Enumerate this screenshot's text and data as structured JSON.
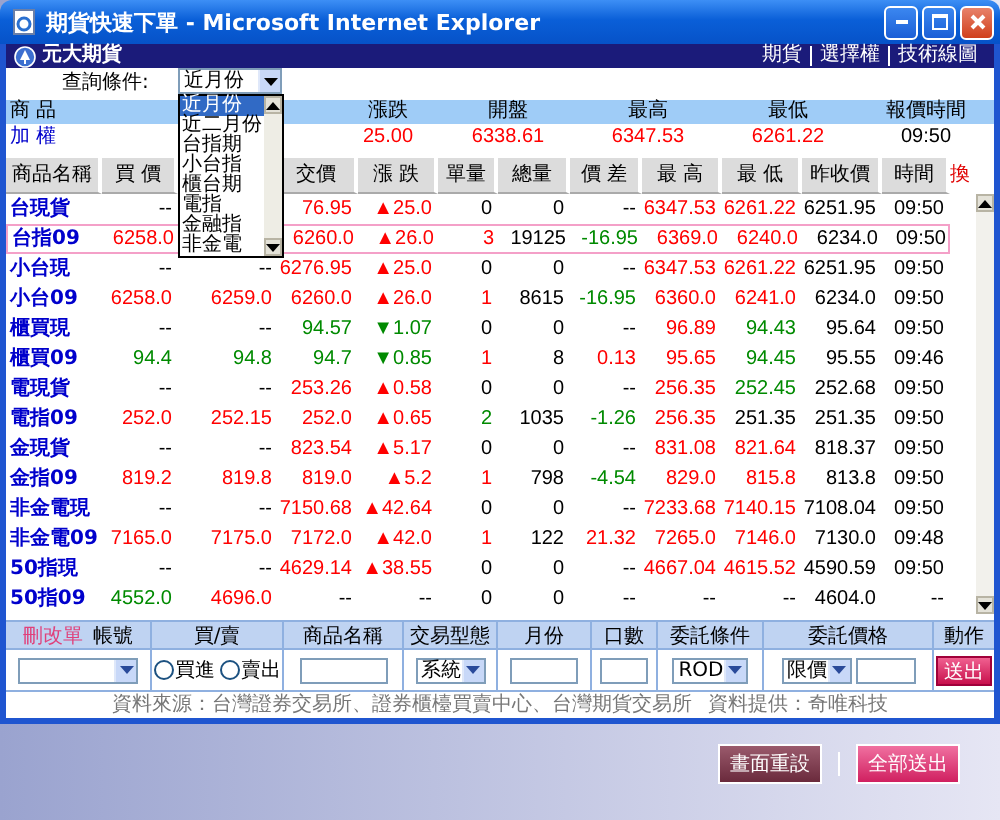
{
  "window": {
    "title": "期貨快速下單 - Microsoft Internet Explorer"
  },
  "brand": {
    "name": "元大期貨"
  },
  "nav_links": [
    "期貨",
    "選擇權",
    "技術線圖"
  ],
  "query": {
    "label": "查詢條件:",
    "value": "近月份",
    "expanded": true,
    "options": [
      {
        "label": "近月份",
        "selected": true
      },
      {
        "label": "近二月份",
        "selected": false
      },
      {
        "label": "台指期",
        "selected": false
      },
      {
        "label": "小台指",
        "selected": false
      },
      {
        "label": "櫃台期",
        "selected": false
      },
      {
        "label": "電指",
        "selected": false
      },
      {
        "label": "金融指",
        "selected": false
      },
      {
        "label": "非金電",
        "selected": false
      }
    ]
  },
  "index": {
    "columns": [
      "商 品",
      "漲跌",
      "開盤",
      "最高",
      "最低",
      "報價時間"
    ],
    "row": {
      "name": "加 權",
      "cells": [
        {
          "text": "25.00",
          "color": "#ff0000"
        },
        {
          "text": "6338.61",
          "color": "#ff0000"
        },
        {
          "text": "6347.53",
          "color": "#ff0000"
        },
        {
          "text": "6261.22",
          "color": "#ff0000"
        },
        {
          "text": "09:50",
          "color": "#000000"
        }
      ]
    }
  },
  "quotes": {
    "columns": [
      "商品名稱",
      "買 價",
      "交價",
      "漲 跌",
      "單量",
      "總量",
      "價 差",
      "最 高",
      "最 低",
      "昨收價",
      "時間",
      "換"
    ],
    "rows": [
      {
        "name": "台現貨",
        "selected": false,
        "bid": {
          "text": "--",
          "color": "#000000"
        },
        "last": {
          "text": "76.95",
          "color": "#ff0000"
        },
        "change": {
          "text": "▲25.0",
          "color": "#ff0000"
        },
        "volume": {
          "text": "0",
          "color": "#000000"
        },
        "total_volume": {
          "text": "0",
          "color": "#000000"
        },
        "spread": {
          "text": "--",
          "color": "#000000"
        },
        "high": {
          "text": "6347.53",
          "color": "#ff0000"
        },
        "low": {
          "text": "6261.22",
          "color": "#ff0000"
        },
        "prev_close": {
          "text": "6251.95",
          "color": "#000000"
        },
        "time": {
          "text": "09:50",
          "color": "#000000"
        }
      },
      {
        "name": "台指09",
        "selected": true,
        "bid": {
          "text": "6258.0",
          "color": "#ff0000"
        },
        "last": {
          "text": "6260.0",
          "color": "#ff0000"
        },
        "change": {
          "text": "▲26.0",
          "color": "#ff0000"
        },
        "volume": {
          "text": "3",
          "color": "#ff0000"
        },
        "total_volume": {
          "text": "19125",
          "color": "#000000"
        },
        "spread": {
          "text": "-16.95",
          "color": "#008a00"
        },
        "high": {
          "text": "6369.0",
          "color": "#ff0000"
        },
        "low": {
          "text": "6240.0",
          "color": "#ff0000"
        },
        "prev_close": {
          "text": "6234.0",
          "color": "#000000"
        },
        "time": {
          "text": "09:50",
          "color": "#000000"
        }
      },
      {
        "name": "小台現",
        "selected": false,
        "bid": {
          "text": "--",
          "color": "#000000"
        },
        "ask": {
          "text": "--",
          "color": "#000000"
        },
        "last": {
          "text": "6276.95",
          "color": "#ff0000"
        },
        "change": {
          "text": "▲25.0",
          "color": "#ff0000"
        },
        "volume": {
          "text": "0",
          "color": "#000000"
        },
        "total_volume": {
          "text": "0",
          "color": "#000000"
        },
        "spread": {
          "text": "--",
          "color": "#000000"
        },
        "high": {
          "text": "6347.53",
          "color": "#ff0000"
        },
        "low": {
          "text": "6261.22",
          "color": "#ff0000"
        },
        "prev_close": {
          "text": "6251.95",
          "color": "#000000"
        },
        "time": {
          "text": "09:50",
          "color": "#000000"
        }
      },
      {
        "name": "小台09",
        "selected": false,
        "bid": {
          "text": "6258.0",
          "color": "#ff0000"
        },
        "ask": {
          "text": "6259.0",
          "color": "#ff0000"
        },
        "last": {
          "text": "6260.0",
          "color": "#ff0000"
        },
        "change": {
          "text": "▲26.0",
          "color": "#ff0000"
        },
        "volume": {
          "text": "1",
          "color": "#ff0000"
        },
        "total_volume": {
          "text": "8615",
          "color": "#000000"
        },
        "spread": {
          "text": "-16.95",
          "color": "#008a00"
        },
        "high": {
          "text": "6360.0",
          "color": "#ff0000"
        },
        "low": {
          "text": "6241.0",
          "color": "#ff0000"
        },
        "prev_close": {
          "text": "6234.0",
          "color": "#000000"
        },
        "time": {
          "text": "09:50",
          "color": "#000000"
        }
      },
      {
        "name": "櫃買現",
        "selected": false,
        "bid": {
          "text": "--",
          "color": "#000000"
        },
        "ask": {
          "text": "--",
          "color": "#000000"
        },
        "last": {
          "text": "94.57",
          "color": "#008a00"
        },
        "change": {
          "text": "▼1.07",
          "color": "#008a00"
        },
        "volume": {
          "text": "0",
          "color": "#000000"
        },
        "total_volume": {
          "text": "0",
          "color": "#000000"
        },
        "spread": {
          "text": "--",
          "color": "#000000"
        },
        "high": {
          "text": "96.89",
          "color": "#ff0000"
        },
        "low": {
          "text": "94.43",
          "color": "#008a00"
        },
        "prev_close": {
          "text": "95.64",
          "color": "#000000"
        },
        "time": {
          "text": "09:50",
          "color": "#000000"
        }
      },
      {
        "name": "櫃買09",
        "selected": false,
        "bid": {
          "text": "94.4",
          "color": "#008a00"
        },
        "ask": {
          "text": "94.8",
          "color": "#008a00"
        },
        "last": {
          "text": "94.7",
          "color": "#008a00"
        },
        "change": {
          "text": "▼0.85",
          "color": "#008a00"
        },
        "volume": {
          "text": "1",
          "color": "#ff0000"
        },
        "total_volume": {
          "text": "8",
          "color": "#000000"
        },
        "spread": {
          "text": "0.13",
          "color": "#ff0000"
        },
        "high": {
          "text": "95.65",
          "color": "#ff0000"
        },
        "low": {
          "text": "94.45",
          "color": "#008a00"
        },
        "prev_close": {
          "text": "95.55",
          "color": "#000000"
        },
        "time": {
          "text": "09:46",
          "color": "#000000"
        }
      },
      {
        "name": "電現貨",
        "selected": false,
        "bid": {
          "text": "--",
          "color": "#000000"
        },
        "ask": {
          "text": "--",
          "color": "#000000"
        },
        "last": {
          "text": "253.26",
          "color": "#ff0000"
        },
        "change": {
          "text": "▲0.58",
          "color": "#ff0000"
        },
        "volume": {
          "text": "0",
          "color": "#000000"
        },
        "total_volume": {
          "text": "0",
          "color": "#000000"
        },
        "spread": {
          "text": "--",
          "color": "#000000"
        },
        "high": {
          "text": "256.35",
          "color": "#ff0000"
        },
        "low": {
          "text": "252.45",
          "color": "#008a00"
        },
        "prev_close": {
          "text": "252.68",
          "color": "#000000"
        },
        "time": {
          "text": "09:50",
          "color": "#000000"
        }
      },
      {
        "name": "電指09",
        "selected": false,
        "bid": {
          "text": "252.0",
          "color": "#ff0000"
        },
        "ask": {
          "text": "252.15",
          "color": "#ff0000"
        },
        "last": {
          "text": "252.0",
          "color": "#ff0000"
        },
        "change": {
          "text": "▲0.65",
          "color": "#ff0000"
        },
        "volume": {
          "text": "2",
          "color": "#008a00"
        },
        "total_volume": {
          "text": "1035",
          "color": "#000000"
        },
        "spread": {
          "text": "-1.26",
          "color": "#008a00"
        },
        "high": {
          "text": "256.35",
          "color": "#ff0000"
        },
        "low": {
          "text": "251.35",
          "color": "#000000"
        },
        "prev_close": {
          "text": "251.35",
          "color": "#000000"
        },
        "time": {
          "text": "09:50",
          "color": "#000000"
        }
      },
      {
        "name": "金現貨",
        "selected": false,
        "bid": {
          "text": "--",
          "color": "#000000"
        },
        "ask": {
          "text": "--",
          "color": "#000000"
        },
        "last": {
          "text": "823.54",
          "color": "#ff0000"
        },
        "change": {
          "text": "▲5.17",
          "color": "#ff0000"
        },
        "volume": {
          "text": "0",
          "color": "#000000"
        },
        "total_volume": {
          "text": "0",
          "color": "#000000"
        },
        "spread": {
          "text": "--",
          "color": "#000000"
        },
        "high": {
          "text": "831.08",
          "color": "#ff0000"
        },
        "low": {
          "text": "821.64",
          "color": "#ff0000"
        },
        "prev_close": {
          "text": "818.37",
          "color": "#000000"
        },
        "time": {
          "text": "09:50",
          "color": "#000000"
        }
      },
      {
        "name": "金指09",
        "selected": false,
        "bid": {
          "text": "819.2",
          "color": "#ff0000"
        },
        "ask": {
          "text": "819.8",
          "color": "#ff0000"
        },
        "last": {
          "text": "819.0",
          "color": "#ff0000"
        },
        "change": {
          "text": "▲5.2",
          "color": "#ff0000"
        },
        "volume": {
          "text": "1",
          "color": "#ff0000"
        },
        "total_volume": {
          "text": "798",
          "color": "#000000"
        },
        "spread": {
          "text": "-4.54",
          "color": "#008a00"
        },
        "high": {
          "text": "829.0",
          "color": "#ff0000"
        },
        "low": {
          "text": "815.8",
          "color": "#ff0000"
        },
        "prev_close": {
          "text": "813.8",
          "color": "#000000"
        },
        "time": {
          "text": "09:50",
          "color": "#000000"
        }
      },
      {
        "name": "非金電現",
        "selected": false,
        "bid": {
          "text": "--",
          "color": "#000000"
        },
        "ask": {
          "text": "--",
          "color": "#000000"
        },
        "last": {
          "text": "7150.68",
          "color": "#ff0000"
        },
        "change": {
          "text": "▲42.64",
          "color": "#ff0000"
        },
        "volume": {
          "text": "0",
          "color": "#000000"
        },
        "total_volume": {
          "text": "0",
          "color": "#000000"
        },
        "spread": {
          "text": "--",
          "color": "#000000"
        },
        "high": {
          "text": "7233.68",
          "color": "#ff0000"
        },
        "low": {
          "text": "7140.15",
          "color": "#ff0000"
        },
        "prev_close": {
          "text": "7108.04",
          "color": "#000000"
        },
        "time": {
          "text": "09:50",
          "color": "#000000"
        }
      },
      {
        "name": "非金電09",
        "selected": false,
        "bid": {
          "text": "7165.0",
          "color": "#ff0000"
        },
        "ask": {
          "text": "7175.0",
          "color": "#ff0000"
        },
        "last": {
          "text": "7172.0",
          "color": "#ff0000"
        },
        "change": {
          "text": "▲42.0",
          "color": "#ff0000"
        },
        "volume": {
          "text": "1",
          "color": "#ff0000"
        },
        "total_volume": {
          "text": "122",
          "color": "#000000"
        },
        "spread": {
          "text": "21.32",
          "color": "#ff0000"
        },
        "high": {
          "text": "7265.0",
          "color": "#ff0000"
        },
        "low": {
          "text": "7146.0",
          "color": "#ff0000"
        },
        "prev_close": {
          "text": "7130.0",
          "color": "#000000"
        },
        "time": {
          "text": "09:48",
          "color": "#000000"
        }
      },
      {
        "name": "50指現",
        "selected": false,
        "bid": {
          "text": "--",
          "color": "#000000"
        },
        "ask": {
          "text": "--",
          "color": "#000000"
        },
        "last": {
          "text": "4629.14",
          "color": "#ff0000"
        },
        "change": {
          "text": "▲38.55",
          "color": "#ff0000"
        },
        "volume": {
          "text": "0",
          "color": "#000000"
        },
        "total_volume": {
          "text": "0",
          "color": "#000000"
        },
        "spread": {
          "text": "--",
          "color": "#000000"
        },
        "high": {
          "text": "4667.04",
          "color": "#ff0000"
        },
        "low": {
          "text": "4615.52",
          "color": "#ff0000"
        },
        "prev_close": {
          "text": "4590.59",
          "color": "#000000"
        },
        "time": {
          "text": "09:50",
          "color": "#000000"
        }
      },
      {
        "name": "50指09",
        "selected": false,
        "bid": {
          "text": "4552.0",
          "color": "#008a00"
        },
        "ask": {
          "text": "4696.0",
          "color": "#ff0000"
        },
        "last": {
          "text": "--",
          "color": "#000000"
        },
        "change": {
          "text": "--",
          "color": "#000000"
        },
        "volume": {
          "text": "0",
          "color": "#000000"
        },
        "total_volume": {
          "text": "0",
          "color": "#000000"
        },
        "spread": {
          "text": "--",
          "color": "#000000"
        },
        "high": {
          "text": "--",
          "color": "#000000"
        },
        "low": {
          "text": "--",
          "color": "#000000"
        },
        "prev_close": {
          "text": "4604.0",
          "color": "#000000"
        },
        "time": {
          "text": "--",
          "color": "#000000"
        }
      }
    ]
  },
  "order_form": {
    "edit_link": "刪改單",
    "columns": [
      "帳號",
      "買/賣",
      "商品名稱",
      "交易型態",
      "月份",
      "口數",
      "委託條件",
      "委託價格",
      "動作"
    ],
    "side_options": [
      {
        "label": "買進",
        "selected": false
      },
      {
        "label": "賣出",
        "selected": false
      }
    ],
    "trade_type": "系統",
    "condition": "ROD",
    "price_type": "限價",
    "submit": "送出"
  },
  "footer": {
    "source": "資料來源：台灣證券交易所、證券櫃檯買賣中心、台灣期貨交易所",
    "provider": "資料提供：奇唯科技"
  },
  "actions": [
    "畫面重設",
    "全部送出"
  ]
}
